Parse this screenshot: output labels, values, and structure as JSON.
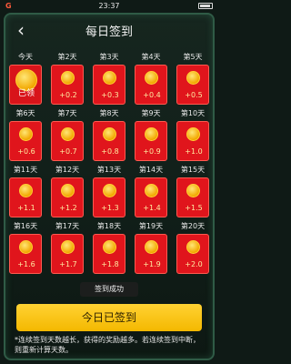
{
  "status_bar": {
    "carrier": "G",
    "time": "23:37"
  },
  "header": {
    "title": "每日签到",
    "close_icon": "close-icon"
  },
  "days": [
    {
      "label": "今天",
      "reward": "已领",
      "signed": true
    },
    {
      "label": "第2天",
      "reward": "+0.2",
      "signed": false
    },
    {
      "label": "第3天",
      "reward": "+0.3",
      "signed": false
    },
    {
      "label": "第4天",
      "reward": "+0.4",
      "signed": false
    },
    {
      "label": "第5天",
      "reward": "+0.5",
      "signed": false
    },
    {
      "label": "第6天",
      "reward": "+0.6",
      "signed": false
    },
    {
      "label": "第7天",
      "reward": "+0.7",
      "signed": false
    },
    {
      "label": "第8天",
      "reward": "+0.8",
      "signed": false
    },
    {
      "label": "第9天",
      "reward": "+0.9",
      "signed": false
    },
    {
      "label": "第10天",
      "reward": "+1.0",
      "signed": false
    },
    {
      "label": "第11天",
      "reward": "+1.1",
      "signed": false
    },
    {
      "label": "第12天",
      "reward": "+1.2",
      "signed": false
    },
    {
      "label": "第13天",
      "reward": "+1.3",
      "signed": false
    },
    {
      "label": "第14天",
      "reward": "+1.4",
      "signed": false
    },
    {
      "label": "第15天",
      "reward": "+1.5",
      "signed": false
    },
    {
      "label": "第16天",
      "reward": "+1.6",
      "signed": false
    },
    {
      "label": "第17天",
      "reward": "+1.7",
      "signed": false
    },
    {
      "label": "第18天",
      "reward": "+1.8",
      "signed": false
    },
    {
      "label": "第19天",
      "reward": "+1.9",
      "signed": false
    },
    {
      "label": "第20天",
      "reward": "+2.0",
      "signed": false
    }
  ],
  "toast": "签到成功",
  "checkin_button": "今日已签到",
  "rules_text": "*连续签到天数越长，获得的奖励越多。若连续签到中断，则重新计算天数。",
  "colors": {
    "card_red": "#e0151c",
    "button_yellow": "#ffd233",
    "panel_border": "#2f5b46"
  }
}
